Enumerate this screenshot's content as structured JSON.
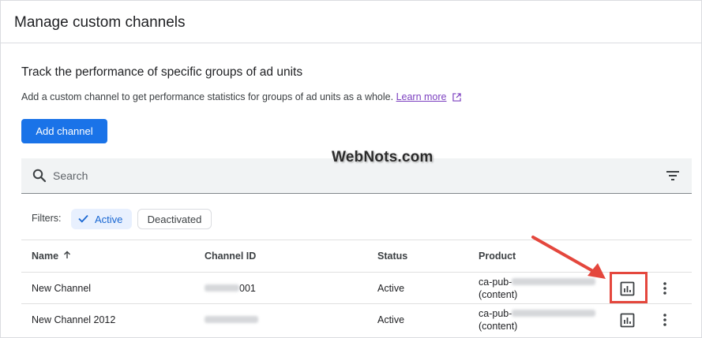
{
  "header": {
    "title": "Manage custom channels"
  },
  "section": {
    "title": "Track the performance of specific groups of ad units",
    "description": "Add a custom channel to get performance statistics for groups of ad units as a whole.",
    "learn_more": "Learn more",
    "add_button": "Add channel"
  },
  "watermark": "WebNots.com",
  "search": {
    "placeholder": "Search"
  },
  "filters": {
    "label": "Filters:",
    "chips": [
      "Active",
      "Deactivated"
    ],
    "selected": "Active"
  },
  "table": {
    "columns": [
      "Name",
      "Channel ID",
      "Status",
      "Product"
    ],
    "rows": [
      {
        "name": "New Channel",
        "channel_id_suffix": "001",
        "status": "Active",
        "product_prefix": "ca-pub-",
        "product_type": "(content)"
      },
      {
        "name": "New Channel 2012",
        "channel_id_suffix": "",
        "status": "Active",
        "product_prefix": "ca-pub-",
        "product_type": "(content)"
      }
    ]
  },
  "colors": {
    "primary": "#1a73e8",
    "highlight": "#e4473d",
    "chip_bg": "#e8f0fe"
  }
}
